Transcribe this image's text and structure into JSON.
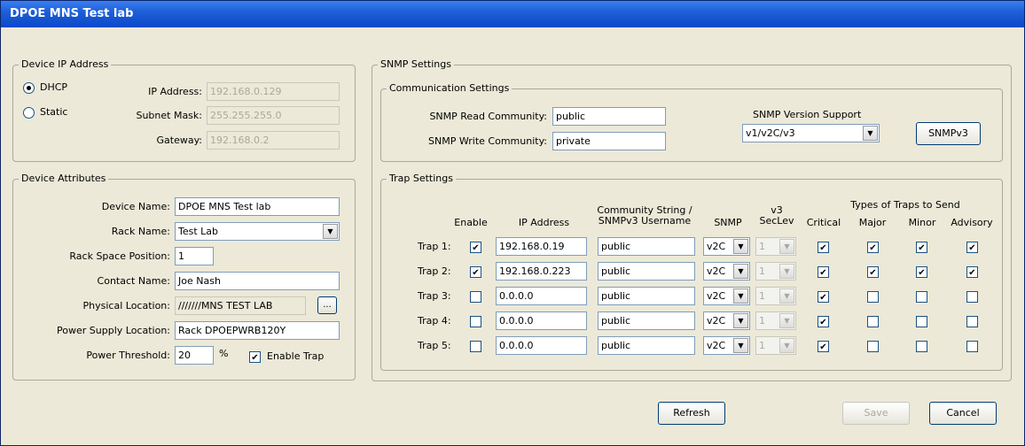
{
  "window": {
    "title": "DPOE MNS Test lab"
  },
  "device_ip": {
    "legend": "Device IP Address",
    "dhcp_label": "DHCP",
    "static_label": "Static",
    "mode": "DHCP",
    "ip_label": "IP Address:",
    "ip_value": "192.168.0.129",
    "subnet_label": "Subnet Mask:",
    "subnet_value": "255.255.255.0",
    "gateway_label": "Gateway:",
    "gateway_value": "192.168.0.2"
  },
  "device_attributes": {
    "legend": "Device Attributes",
    "device_name_label": "Device Name:",
    "device_name_value": "DPOE MNS Test lab",
    "rack_name_label": "Rack Name:",
    "rack_name_value": "Test Lab",
    "rack_space_label": "Rack Space Position:",
    "rack_space_value": "1",
    "contact_label": "Contact Name:",
    "contact_value": "Joe Nash",
    "physical_label": "Physical Location:",
    "physical_value": "///////MNS TEST LAB",
    "browse_label": "...",
    "psu_label": "Power Supply Location:",
    "psu_value": "Rack DPOEPWRB120Y",
    "threshold_label": "Power Threshold:",
    "threshold_value": "20",
    "threshold_unit": "%",
    "enable_trap_label": "Enable Trap",
    "enable_trap_checked": true
  },
  "snmp": {
    "legend": "SNMP Settings",
    "comm_legend": "Communication Settings",
    "read_label": "SNMP Read Community:",
    "read_value": "public",
    "write_label": "SNMP Write Community:",
    "write_value": "private",
    "version_label": "SNMP Version Support",
    "version_value": "v1/v2C/v3",
    "snmpv3_button": "SNMPv3"
  },
  "traps": {
    "legend": "Trap Settings",
    "headers": {
      "enable": "Enable",
      "ip": "IP Address",
      "community_1": "Community String /",
      "community_2": "SNMPv3 Username",
      "snmp": "SNMP",
      "v3_1": "v3",
      "v3_2": "SecLev",
      "types_group": "Types of Traps to Send",
      "critical": "Critical",
      "major": "Major",
      "minor": "Minor",
      "advisory": "Advisory"
    },
    "rows": [
      {
        "label": "Trap 1:",
        "enabled": true,
        "ip": "192.168.0.19",
        "community": "public",
        "snmp": "v2C",
        "seclev": "1",
        "critical": true,
        "major": true,
        "minor": true,
        "advisory": true
      },
      {
        "label": "Trap 2:",
        "enabled": true,
        "ip": "192.168.0.223",
        "community": "public",
        "snmp": "v2C",
        "seclev": "1",
        "critical": true,
        "major": true,
        "minor": true,
        "advisory": true
      },
      {
        "label": "Trap 3:",
        "enabled": false,
        "ip": "0.0.0.0",
        "community": "public",
        "snmp": "v2C",
        "seclev": "1",
        "critical": true,
        "major": false,
        "minor": false,
        "advisory": false
      },
      {
        "label": "Trap 4:",
        "enabled": false,
        "ip": "0.0.0.0",
        "community": "public",
        "snmp": "v2C",
        "seclev": "1",
        "critical": true,
        "major": false,
        "minor": false,
        "advisory": false
      },
      {
        "label": "Trap 5:",
        "enabled": false,
        "ip": "0.0.0.0",
        "community": "public",
        "snmp": "v2C",
        "seclev": "1",
        "critical": true,
        "major": false,
        "minor": false,
        "advisory": false
      }
    ]
  },
  "footer": {
    "refresh_label": "Refresh",
    "save_label": "Save",
    "cancel_label": "Cancel"
  }
}
